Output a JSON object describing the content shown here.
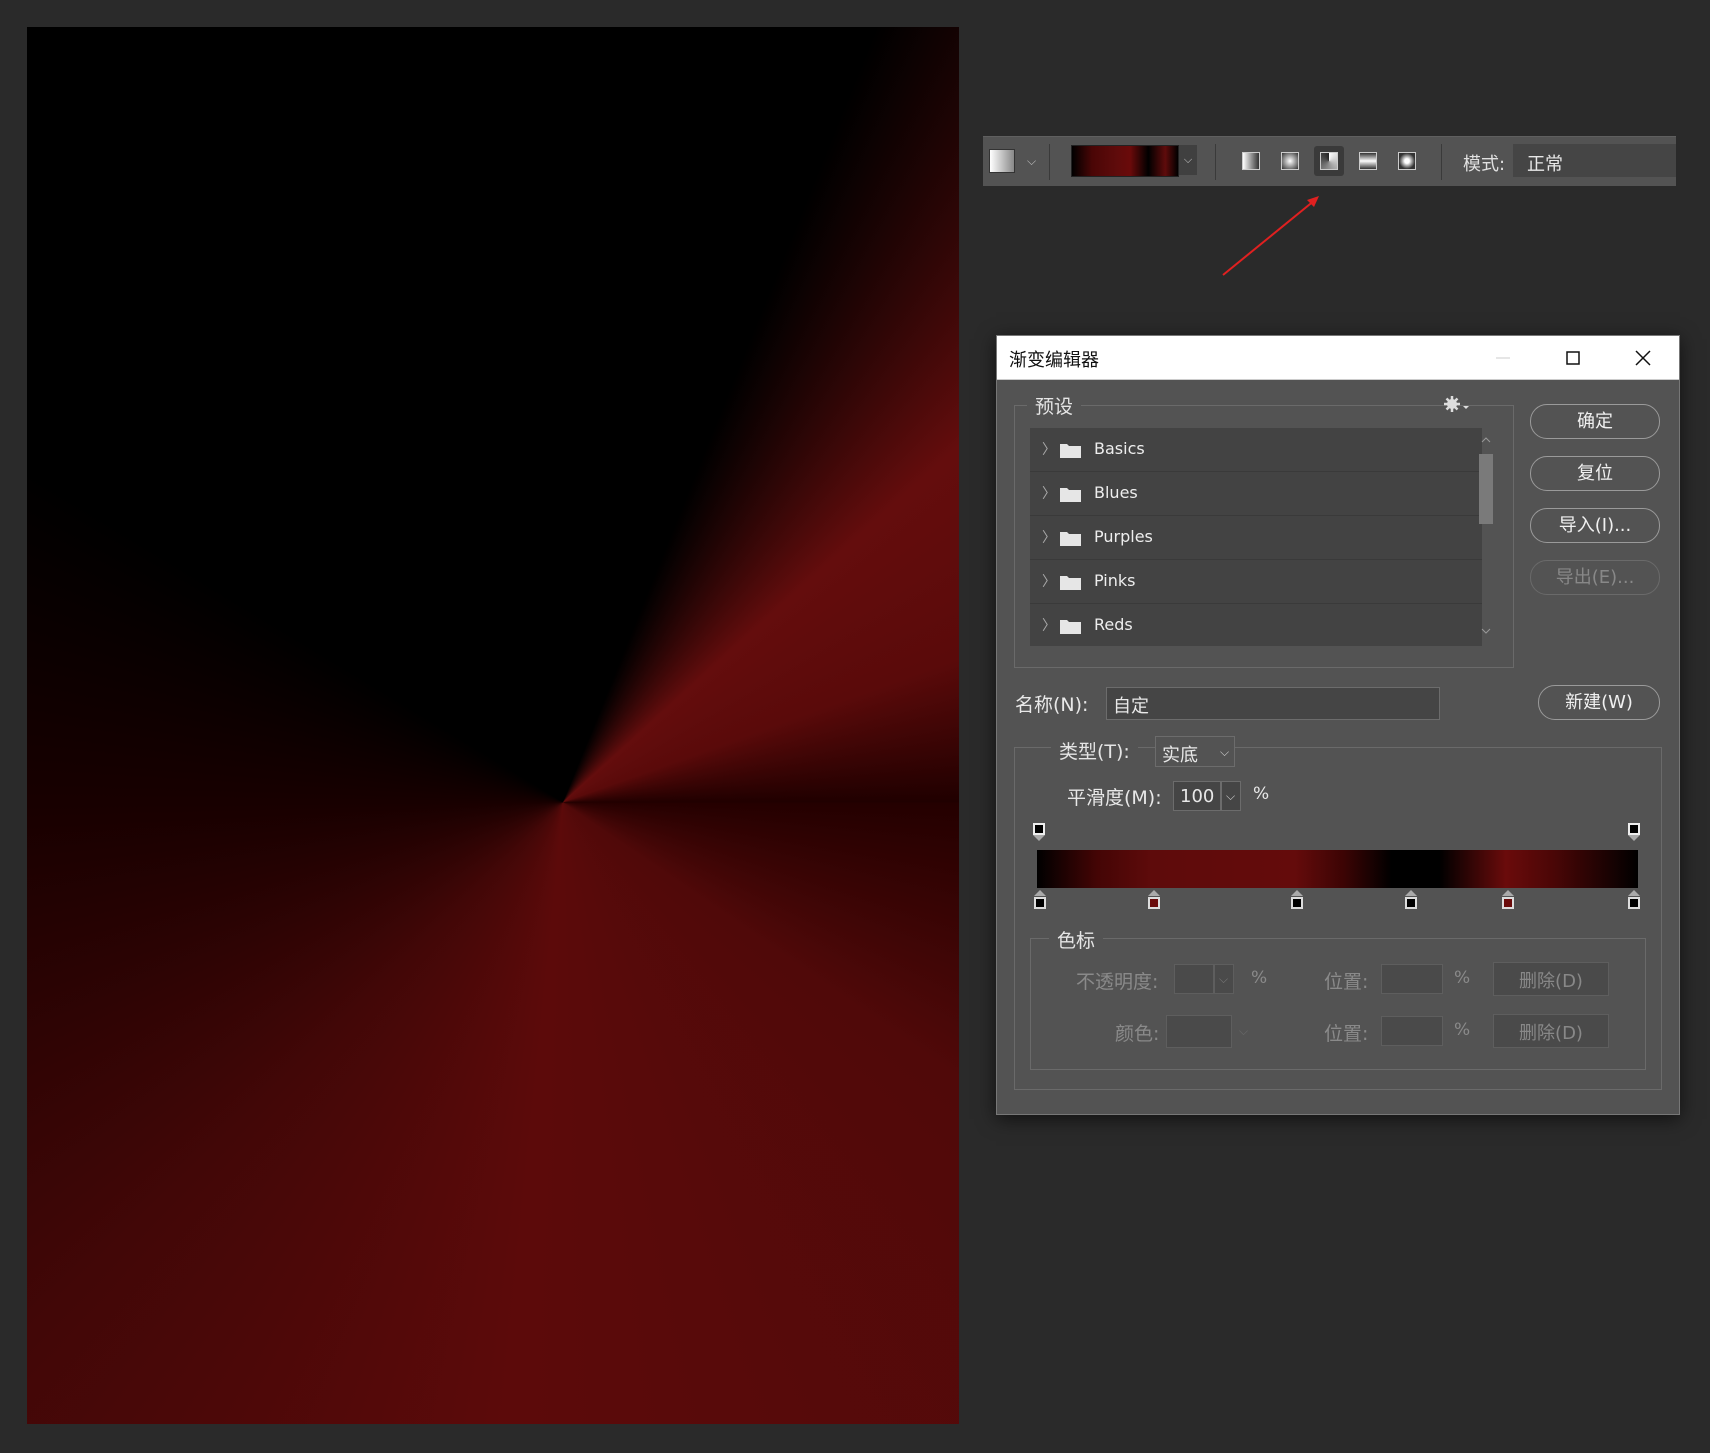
{
  "colors": {
    "background": "#2a2a2a",
    "panel": "#535353",
    "gradient_dark": "#000000",
    "gradient_red": "#640b0b",
    "annotation_arrow": "#e02020"
  },
  "options_bar": {
    "mode_label": "模式:",
    "mode_value": "正常",
    "gradient_types": [
      {
        "name": "linear",
        "active": false
      },
      {
        "name": "radial",
        "active": false
      },
      {
        "name": "angle",
        "active": true
      },
      {
        "name": "reflected",
        "active": false
      },
      {
        "name": "diamond",
        "active": false
      }
    ]
  },
  "dialog": {
    "title": "渐变编辑器",
    "presets": {
      "title": "预设",
      "items": [
        "Basics",
        "Blues",
        "Purples",
        "Pinks",
        "Reds"
      ]
    },
    "buttons": {
      "ok": "确定",
      "reset": "复位",
      "import": "导入(I)...",
      "export": "导出(E)...",
      "new": "新建(W)"
    },
    "name_label": "名称(N):",
    "name_value": "自定",
    "type_label": "类型(T):",
    "type_value": "实底",
    "smoothness_label": "平滑度(M):",
    "smoothness_value": "100",
    "percent": "%",
    "stops": {
      "title": "色标",
      "opacity_label": "不透明度:",
      "location_label": "位置:",
      "color_label": "颜色:",
      "delete_label": "删除(D)",
      "percent": "%"
    },
    "color_stop_locations_percent": [
      0,
      19,
      43,
      62,
      78,
      100
    ],
    "color_stop_colors": [
      "#000000",
      "#6a0b0b",
      "#000000",
      "#000000",
      "#6a0b0b",
      "#000000"
    ],
    "opacity_stop_locations_percent": [
      0,
      100
    ]
  }
}
